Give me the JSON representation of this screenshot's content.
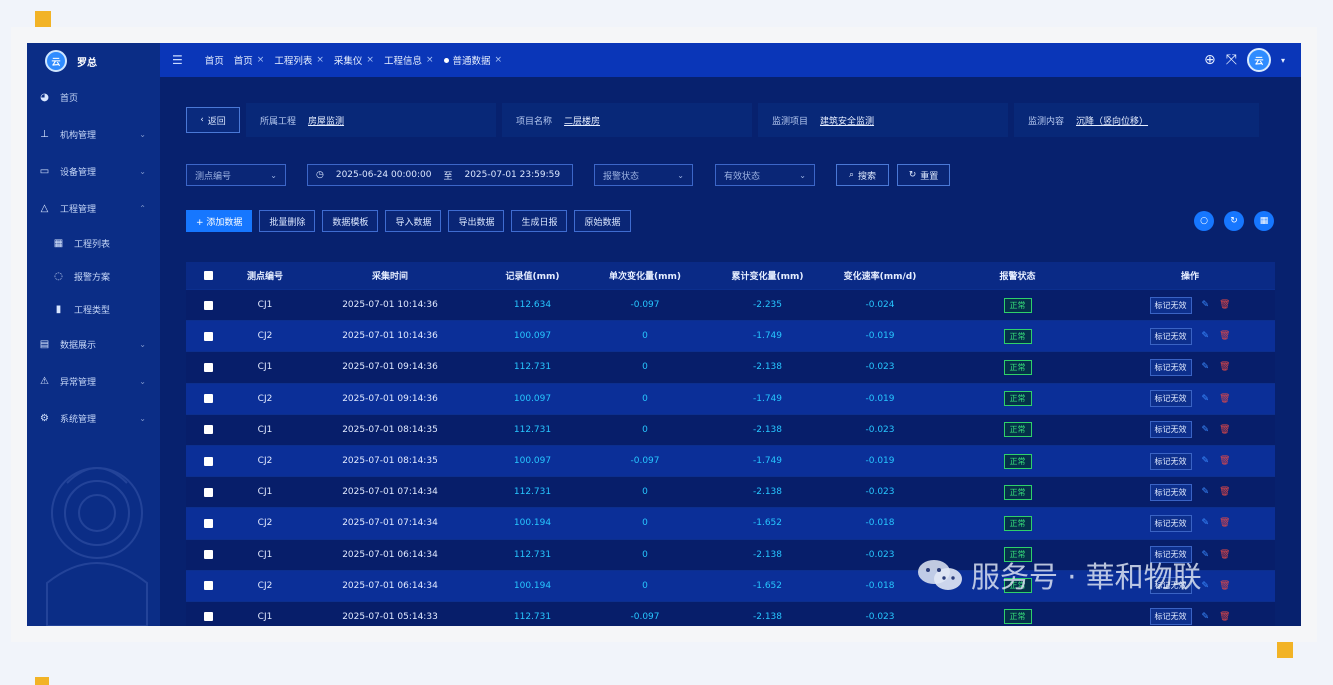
{
  "brand": {
    "name": "罗总",
    "logo_text": "云"
  },
  "sidebar": {
    "items": [
      {
        "label": "首页",
        "icon": "dashboard-icon",
        "arrow": ""
      },
      {
        "label": "机构管理",
        "icon": "org-tree-icon",
        "arrow": "⌄"
      },
      {
        "label": "设备管理",
        "icon": "monitor-icon",
        "arrow": "⌄"
      },
      {
        "label": "工程管理",
        "icon": "engineering-icon",
        "arrow": "⌃"
      },
      {
        "label": "工程列表",
        "icon": "building-icon",
        "arrow": ""
      },
      {
        "label": "报警方案",
        "icon": "alarm-plan-icon",
        "arrow": ""
      },
      {
        "label": "工程类型",
        "icon": "bar-chart-icon",
        "arrow": ""
      },
      {
        "label": "数据展示",
        "icon": "data-display-icon",
        "arrow": "⌄"
      },
      {
        "label": "异常管理",
        "icon": "warning-icon",
        "arrow": "⌄"
      },
      {
        "label": "系统管理",
        "icon": "gear-icon",
        "arrow": "⌄"
      }
    ]
  },
  "topbar": {
    "tabs": [
      {
        "label": "首页",
        "closable": false,
        "active": false
      },
      {
        "label": "首页",
        "closable": true,
        "active": false
      },
      {
        "label": "工程列表",
        "closable": true,
        "active": false
      },
      {
        "label": "采集仪",
        "closable": true,
        "active": false
      },
      {
        "label": "工程信息",
        "closable": true,
        "active": false
      },
      {
        "label": "普通数据",
        "closable": true,
        "active": true
      }
    ],
    "close_glyph": "×"
  },
  "infobar": {
    "back_label": "返回",
    "project_label": "所属工程",
    "project_value": "房屋监测",
    "item_label": "项目名称",
    "item_value": "二层楼房",
    "monitor_label": "监测项目",
    "monitor_value": "建筑安全监测",
    "content_label": "监测内容",
    "content_value": "沉降（竖向位移）"
  },
  "filters": {
    "point_placeholder": "测点编号",
    "date_start": "2025-06-24 00:00:00",
    "date_sep": "至",
    "date_end": "2025-07-01 23:59:59",
    "alarm_placeholder": "报警状态",
    "valid_placeholder": "有效状态",
    "search_label": "搜索",
    "reset_label": "重置"
  },
  "actions": {
    "add": "+ 添加数据",
    "batch_delete": "批量删除",
    "template": "数据模板",
    "import": "导入数据",
    "export": "导出数据",
    "report": "生成日报",
    "raw": "原始数据"
  },
  "table": {
    "headers": [
      "测点编号",
      "采集时间",
      "记录值(mm)",
      "单次变化量(mm)",
      "累计变化量(mm)",
      "变化速率(mm/d)",
      "报警状态",
      "操作"
    ],
    "rows": [
      {
        "point": "CJ1",
        "time": "2025-07-01 10:14:36",
        "value": "112.634",
        "single": "-0.097",
        "total": "-2.235",
        "rate": "-0.024",
        "status": "正常",
        "op": "标记无效"
      },
      {
        "point": "CJ2",
        "time": "2025-07-01 10:14:36",
        "value": "100.097",
        "single": "0",
        "total": "-1.749",
        "rate": "-0.019",
        "status": "正常",
        "op": "标记无效"
      },
      {
        "point": "CJ1",
        "time": "2025-07-01 09:14:36",
        "value": "112.731",
        "single": "0",
        "total": "-2.138",
        "rate": "-0.023",
        "status": "正常",
        "op": "标记无效"
      },
      {
        "point": "CJ2",
        "time": "2025-07-01 09:14:36",
        "value": "100.097",
        "single": "0",
        "total": "-1.749",
        "rate": "-0.019",
        "status": "正常",
        "op": "标记无效"
      },
      {
        "point": "CJ1",
        "time": "2025-07-01 08:14:35",
        "value": "112.731",
        "single": "0",
        "total": "-2.138",
        "rate": "-0.023",
        "status": "正常",
        "op": "标记无效"
      },
      {
        "point": "CJ2",
        "time": "2025-07-01 08:14:35",
        "value": "100.097",
        "single": "-0.097",
        "total": "-1.749",
        "rate": "-0.019",
        "status": "正常",
        "op": "标记无效"
      },
      {
        "point": "CJ1",
        "time": "2025-07-01 07:14:34",
        "value": "112.731",
        "single": "0",
        "total": "-2.138",
        "rate": "-0.023",
        "status": "正常",
        "op": "标记无效"
      },
      {
        "point": "CJ2",
        "time": "2025-07-01 07:14:34",
        "value": "100.194",
        "single": "0",
        "total": "-1.652",
        "rate": "-0.018",
        "status": "正常",
        "op": "标记无效"
      },
      {
        "point": "CJ1",
        "time": "2025-07-01 06:14:34",
        "value": "112.731",
        "single": "0",
        "total": "-2.138",
        "rate": "-0.023",
        "status": "正常",
        "op": "标记无效"
      },
      {
        "point": "CJ2",
        "time": "2025-07-01 06:14:34",
        "value": "100.194",
        "single": "0",
        "total": "-1.652",
        "rate": "-0.018",
        "status": "正常",
        "op": "标记无效"
      },
      {
        "point": "CJ1",
        "time": "2025-07-01 05:14:33",
        "value": "112.731",
        "single": "-0.097",
        "total": "-2.138",
        "rate": "-0.023",
        "status": "正常",
        "op": "标记无效"
      }
    ]
  },
  "watermark": {
    "text": "服务号 · 華和物联"
  },
  "colors": {
    "sidebar": "#0b2d86",
    "topbar": "#0a36b8",
    "primary": "#1677ff",
    "value_cyan": "#27c6ff",
    "status_green": "#37e07a",
    "delete_red": "#e04848"
  }
}
